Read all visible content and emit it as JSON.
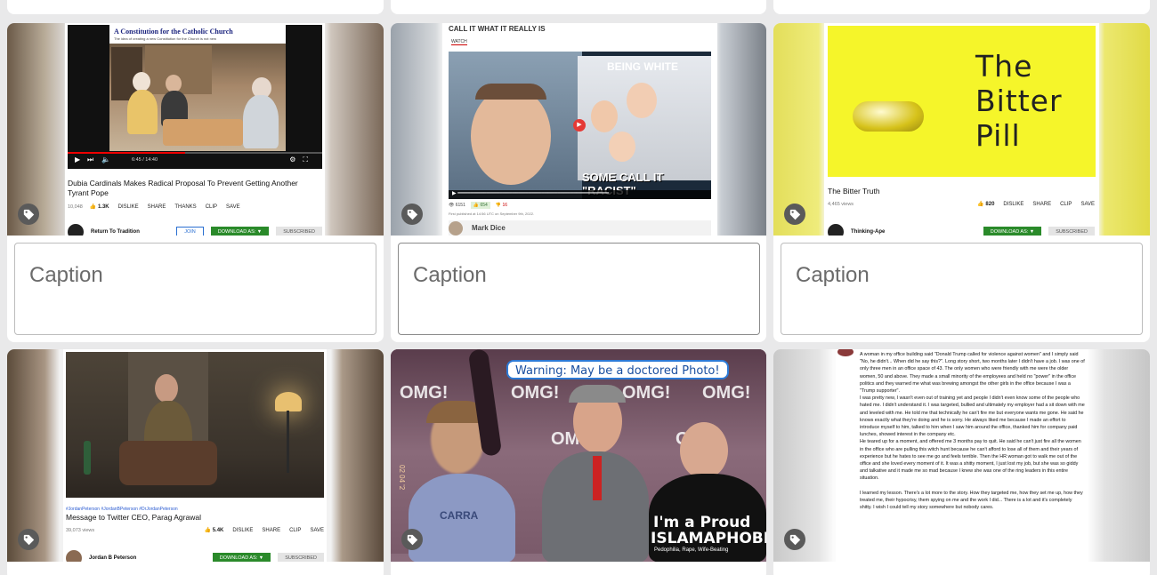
{
  "caption_placeholder": "Caption",
  "cards": [
    {
      "inner_header": "A Constitution for the Catholic Church",
      "inner_subheader": "The idea of creating a new Constitution for the Church is not new",
      "time": "6:45 / 14:40",
      "title": "Dubia Cardinals Makes Radical Proposal To Prevent Getting Another Tyrant Pope",
      "views": "10,048",
      "likes": "1.3K",
      "actions": [
        "DISLIKE",
        "SHARE",
        "THANKS",
        "CLIP",
        "SAVE"
      ],
      "channel": "Return To Tradition",
      "join": "JOIN",
      "download": "DOWNLOAD AS: ▼",
      "subscribed": "SUBSCRIBED"
    },
    {
      "inner_header": "CALL IT WHAT IT REALLY IS",
      "watch": "WATCH",
      "overlay_top": "BEING WHITE",
      "overlay_bottom": "SOME CALL IT \"RACIST\"",
      "views": "6151",
      "likes": "654",
      "dislikes": "16",
      "published": "First published at 14:56 UTC on September 9th, 2022.",
      "channel": "Mark Dice"
    },
    {
      "book_title": "The Bitter Pill",
      "title": "The Bitter Truth",
      "views": "4,465 views",
      "likes": "820",
      "actions": [
        "DISLIKE",
        "SHARE",
        "CLIP",
        "SAVE"
      ],
      "channel": "Thinking-Ape",
      "download": "DOWNLOAD AS: ▼",
      "subscribed": "SUBSCRIBED"
    },
    {
      "hashtags": "#JordanPeterson #JordanBPeterson #DrJordanPeterson",
      "title": "Message to Twitter CEO, Parag Agrawal",
      "views": "39,073 views",
      "likes": "5.4K",
      "actions": [
        "DISLIKE",
        "SHARE",
        "CLIP",
        "SAVE"
      ],
      "channel": "Jordan B Peterson",
      "download": "DOWNLOAD AS: ▼",
      "subscribed": "SUBSCRIBED"
    },
    {
      "warning": "Warning: May be a doctored Photo!",
      "omg": "OMG!",
      "shirt_line1": "I'm a Proud",
      "shirt_line2": "ISLAMAPHOBE",
      "shirt_line3": "Pedophilia, Rape, Wife-Beating",
      "shirt_left": "CARRA",
      "date_stamp": "02 04 '2"
    },
    {
      "post_text": [
        "A woman in my office building said \"Donald Trump called for violence against women\" and I simply said \"No, he didn't... When did he say this?\". Long story short, two months later I didn't have a job. I was one of only three men in an office space of 43. The only women who were friendly with me were the older women, 50 and above. They made a small minority of the employees and held no \"power\" in the office politics and they warned me what was brewing amongst the other girls in the office because I was a \"Trump supporter\".",
        "I was pretty new, I wasn't even out of training yet and people I didn't even know some of the people who hated me. I didn't understand it. I was targeted, bullied and ultimately my employer had a sit down with me and leveled with me. He told me that technically he can't fire me but everyone wants me gone. He said he knows exactly what they're doing and he is sorry. He always liked me because I made an effort to introduce myself to him, talked to him when I saw him around the office, thanked him for company paid lunches, showed interest in the company etc.",
        "He teared up for a moment, and offered me 3 months pay to quit. He said he can't just fire all the women in the office who are pulling this witch hunt because he can't afford to lose all of them and their years of experience but he hates to see me go and feels terrible. Then the HR woman got to walk me out of the office and she loved every moment of it. It was a shitty moment, I just lost my job, but she was so giddy and talkative and it made me so mad because I knew she was one of the ring leaders in this entire situation.",
        "I learned my lesson. There's a lot more to the story. How they targeted me, how they set me up, how they treated me, their hypocrisy, them spying on me and the work I did... There is a lot and it's completely shitty.  I wish I could tell my story somewhere but nobody cares."
      ]
    }
  ]
}
